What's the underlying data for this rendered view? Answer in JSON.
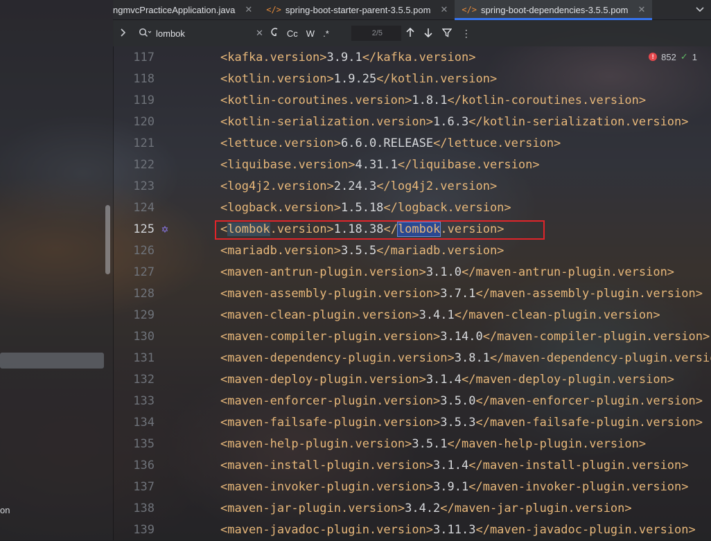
{
  "left_panel": {
    "tail_text": "on"
  },
  "tabs": [
    {
      "label": "ngmvcPracticeApplication.java",
      "icon": "",
      "active": false
    },
    {
      "label": "spring-boot-starter-parent-3.5.5.pom",
      "icon": "</>",
      "active": false
    },
    {
      "label": "spring-boot-dependencies-3.5.5.pom",
      "icon": "</>",
      "active": true
    }
  ],
  "find_bar": {
    "query": "lombok",
    "match_case_label": "Cc",
    "words_label": "W",
    "regex_label": ".*",
    "match_count": "2/5"
  },
  "inspections": {
    "errors": "852",
    "warnings": "1"
  },
  "editor": {
    "current_line": 125,
    "lines": [
      {
        "n": "117",
        "tag": "kafka.version",
        "value": "3.9.1"
      },
      {
        "n": "118",
        "tag": "kotlin.version",
        "value": "1.9.25"
      },
      {
        "n": "119",
        "tag": "kotlin-coroutines.version",
        "value": "1.8.1"
      },
      {
        "n": "120",
        "tag": "kotlin-serialization.version",
        "value": "1.6.3"
      },
      {
        "n": "121",
        "tag": "lettuce.version",
        "value": "6.6.0.RELEASE"
      },
      {
        "n": "122",
        "tag": "liquibase.version",
        "value": "4.31.1"
      },
      {
        "n": "123",
        "tag": "log4j2.version",
        "value": "2.24.3"
      },
      {
        "n": "124",
        "tag": "logback.version",
        "value": "1.5.18"
      },
      {
        "n": "125",
        "tag": "lombok.version",
        "value": "1.18.38"
      },
      {
        "n": "126",
        "tag": "mariadb.version",
        "value": "3.5.5"
      },
      {
        "n": "127",
        "tag": "maven-antrun-plugin.version",
        "value": "3.1.0"
      },
      {
        "n": "128",
        "tag": "maven-assembly-plugin.version",
        "value": "3.7.1"
      },
      {
        "n": "129",
        "tag": "maven-clean-plugin.version",
        "value": "3.4.1"
      },
      {
        "n": "130",
        "tag": "maven-compiler-plugin.version",
        "value": "3.14.0"
      },
      {
        "n": "131",
        "tag": "maven-dependency-plugin.version",
        "value": "3.8.1"
      },
      {
        "n": "132",
        "tag": "maven-deploy-plugin.version",
        "value": "3.1.4"
      },
      {
        "n": "133",
        "tag": "maven-enforcer-plugin.version",
        "value": "3.5.0"
      },
      {
        "n": "134",
        "tag": "maven-failsafe-plugin.version",
        "value": "3.5.3"
      },
      {
        "n": "135",
        "tag": "maven-help-plugin.version",
        "value": "3.5.1"
      },
      {
        "n": "136",
        "tag": "maven-install-plugin.version",
        "value": "3.1.4"
      },
      {
        "n": "137",
        "tag": "maven-invoker-plugin.version",
        "value": "3.9.1"
      },
      {
        "n": "138",
        "tag": "maven-jar-plugin.version",
        "value": "3.4.2"
      },
      {
        "n": "139",
        "tag": "maven-javadoc-plugin.version",
        "value": "3.11.3"
      }
    ]
  }
}
